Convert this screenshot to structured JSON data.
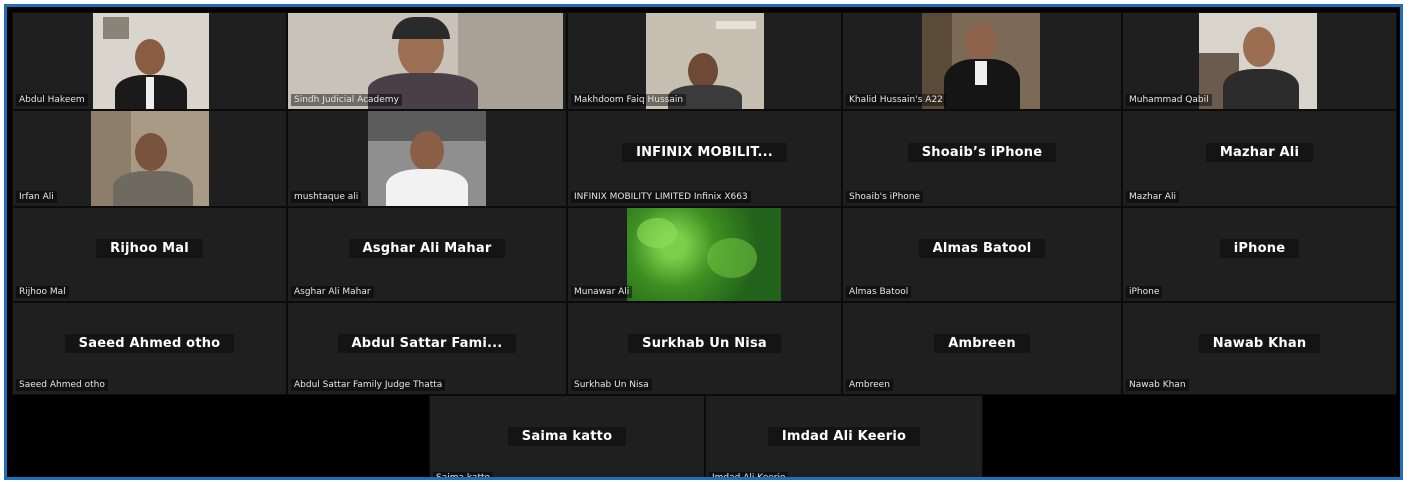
{
  "participants": {
    "r1": [
      {
        "name": "Abdul Hakeem"
      },
      {
        "name": "Sindh Judicial Academy"
      },
      {
        "name": "Makhdoom Faiq Hussain"
      },
      {
        "name": "Khalid Hussain's A22"
      },
      {
        "name": "Muhammad Qabil"
      }
    ],
    "r2": [
      {
        "name": "Irfan Ali"
      },
      {
        "name": "mushtaque ali"
      },
      {
        "big": "INFINIX  MOBILIT...",
        "name": "INFINIX MOBILITY LIMITED Infinix X663"
      },
      {
        "big": "Shoaib’s iPhone",
        "name": "Shoaib's iPhone"
      },
      {
        "big": "Mazhar Ali",
        "name": "Mazhar Ali"
      }
    ],
    "r3": [
      {
        "big": "Rijhoo Mal",
        "name": "Rijhoo Mal"
      },
      {
        "big": "Asghar Ali Mahar",
        "name": "Asghar Ali Mahar"
      },
      {
        "name": "Munawar Ali"
      },
      {
        "big": "Almas Batool",
        "name": "Almas Batool"
      },
      {
        "big": "iPhone",
        "name": "iPhone"
      }
    ],
    "r4": [
      {
        "big": "Saeed Ahmed otho",
        "name": "Saeed Ahmed otho"
      },
      {
        "big": "Abdul Sattar Fami...",
        "name": "Abdul Sattar Family Judge Thatta"
      },
      {
        "big": "Surkhab Un Nisa",
        "name": "Surkhab Un Nisa"
      },
      {
        "big": "Ambreen",
        "name": "Ambreen"
      },
      {
        "big": "Nawab Khan",
        "name": "Nawab Khan"
      }
    ],
    "r5": [
      {
        "big": "Saima katto",
        "name": "Saima katto"
      },
      {
        "big": "Imdad Ali Keerio",
        "name": "Imdad Ali Keerio"
      }
    ]
  },
  "colors": {
    "frame_border": "#1f6fb8",
    "tile_bg": "#1f1f1f",
    "grid_bg": "#000000"
  }
}
